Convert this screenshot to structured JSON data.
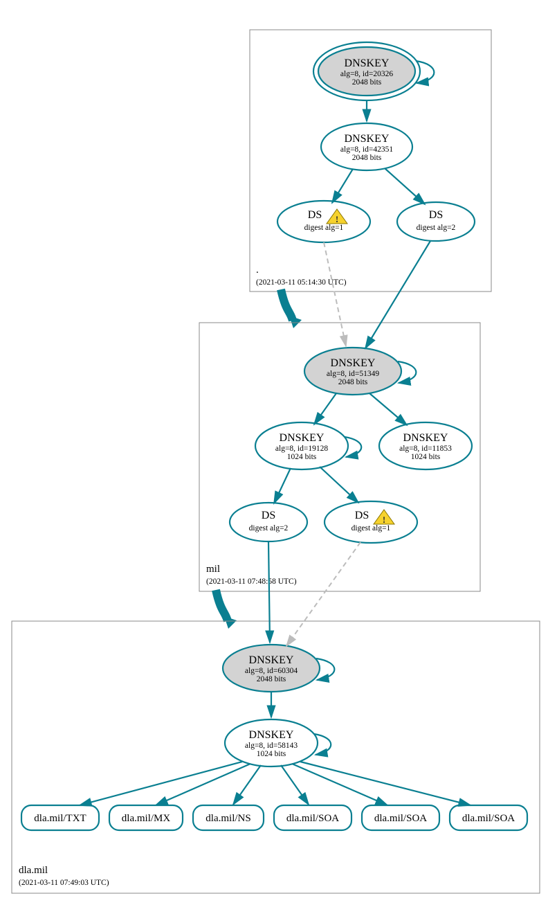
{
  "zones": {
    "root": {
      "label": ".",
      "ts": "(2021-03-11 05:14:30 UTC)"
    },
    "mil": {
      "label": "mil",
      "ts": "(2021-03-11 07:48:58 UTC)"
    },
    "dla": {
      "label": "dla.mil",
      "ts": "(2021-03-11 07:49:03 UTC)"
    }
  },
  "nodes": {
    "root_ksk": {
      "t": "DNSKEY",
      "l1": "alg=8, id=20326",
      "l2": "2048 bits"
    },
    "root_zsk": {
      "t": "DNSKEY",
      "l1": "alg=8, id=42351",
      "l2": "2048 bits"
    },
    "root_ds1": {
      "t": "DS",
      "l1": "digest alg=1"
    },
    "root_ds2": {
      "t": "DS",
      "l1": "digest alg=2"
    },
    "mil_ksk": {
      "t": "DNSKEY",
      "l1": "alg=8, id=51349",
      "l2": "2048 bits"
    },
    "mil_zsk1": {
      "t": "DNSKEY",
      "l1": "alg=8, id=19128",
      "l2": "1024 bits"
    },
    "mil_zsk2": {
      "t": "DNSKEY",
      "l1": "alg=8, id=11853",
      "l2": "1024 bits"
    },
    "mil_ds1": {
      "t": "DS",
      "l1": "digest alg=2"
    },
    "mil_ds2": {
      "t": "DS",
      "l1": "digest alg=1"
    },
    "dla_ksk": {
      "t": "DNSKEY",
      "l1": "alg=8, id=60304",
      "l2": "2048 bits"
    },
    "dla_zsk": {
      "t": "DNSKEY",
      "l1": "alg=8, id=58143",
      "l2": "1024 bits"
    }
  },
  "rrs": [
    "dla.mil/TXT",
    "dla.mil/MX",
    "dla.mil/NS",
    "dla.mil/SOA",
    "dla.mil/SOA",
    "dla.mil/SOA"
  ]
}
